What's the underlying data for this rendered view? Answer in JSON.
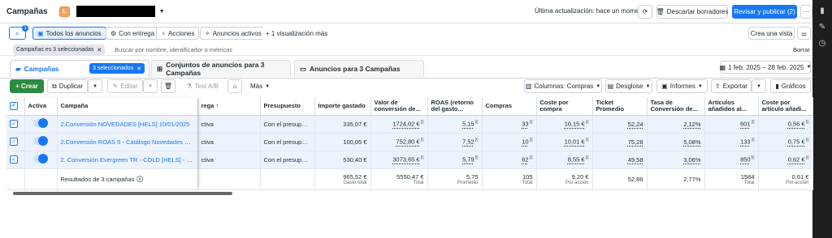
{
  "header": {
    "title": "Campañas",
    "account_badge": "L",
    "last_update": "Última actualización: hace un momento",
    "discard_label": "Descartar borradores",
    "publish_label": "Revisar y publicar (2)",
    "more_label": "···"
  },
  "filters": {
    "search_badge": "1",
    "all_ads": "Todos los anuncios",
    "with_delivery": "Con entrega",
    "actions": "Acciones",
    "active_ads": "Anuncios activos",
    "more_views": "+ 1 visualización más",
    "create_view": "Crea una vista",
    "filter_pill": "Campañas es 3 seleccionadas",
    "search_placeholder": "Buscar por nombre, identificador o métricas",
    "clear": "Borrar"
  },
  "tabs": {
    "campaigns": "Campañas",
    "selected": "3 seleccionados",
    "adsets": "Conjuntos de anuncios para 3 Campañas",
    "ads": "Anuncios para 3 Campañas",
    "date_range": "1 feb. 2025 – 28 feb. 2025"
  },
  "toolbar": {
    "create": "+ Crear",
    "duplicate": "Duplicar",
    "edit": "Editar",
    "test": "Test A/B",
    "more": "Más",
    "columns": "Columnas: Compras",
    "breakdown": "Desglose",
    "reports": "Informes",
    "export": "Exportar",
    "charts": "Gráficos"
  },
  "table": {
    "headers": [
      "Activa",
      "Campaña",
      "rega ↑",
      "Presupuesto",
      "Importe gastado",
      "Valor de conversión de...",
      "ROAS (retorno del gasto...",
      "Compras",
      "Coste por compra",
      "Ticket Promedio",
      "Tasa de Conversión de...",
      "Artículos añadidos al...",
      "Coste por artículo añadi..."
    ],
    "rows": [
      {
        "name": "2.Conversión NOVEDADES [HELS] 10/01/2025",
        "delivery": "ctiva",
        "budget": "Con el presupue...",
        "spend": "335,07 €",
        "conv_value": "1724,02 €",
        "roas": "5,15",
        "purchases": "33",
        "cpp": "10,15 €",
        "ticket": "52,24",
        "rate": "2,12%",
        "atc": "601",
        "cpa": "0,56 €"
      },
      {
        "name": "2.Conversión ROAS 5 - Catálogo Novedades & Reba...",
        "delivery": "ctiva",
        "budget": "Con el presupue...",
        "spend": "100,05 €",
        "conv_value": "752,80 €",
        "roas": "7,52",
        "purchases": "10",
        "cpp": "10,01 €",
        "ticket": "75,28",
        "rate": "5,08%",
        "atc": "133",
        "cpa": "0,75 €"
      },
      {
        "name": "2. Conversión Evergreen TR - COLD [HELS] - 29/10/...",
        "delivery": "ctiva",
        "budget": "Con el presupue...",
        "spend": "530,40 €",
        "conv_value": "3073,65 €",
        "roas": "5,79",
        "purchases": "62",
        "cpp": "8,55 €",
        "ticket": "49,58",
        "rate": "3,06%",
        "atc": "850",
        "cpa": "0,62 €"
      }
    ],
    "footer": {
      "label": "Resultados de 3 campañas",
      "spend": "965,52 €",
      "spend_sub": "Gasto total",
      "conv_value": "5550,47 €",
      "conv_sub": "Total",
      "roas": "5,75",
      "roas_sub": "Promedio",
      "purchases": "105",
      "purchases_sub": "Total",
      "cpp": "9,20 €",
      "cpp_sub": "Por acción",
      "ticket": "52,86",
      "rate": "2,77%",
      "atc": "1584",
      "atc_sub": "Total",
      "cpa": "0,61 €",
      "cpa_sub": "Por acción"
    }
  },
  "colors": {
    "accent": "#1877f2",
    "create": "#2c8a41",
    "row_selected": "#edf3fd"
  }
}
